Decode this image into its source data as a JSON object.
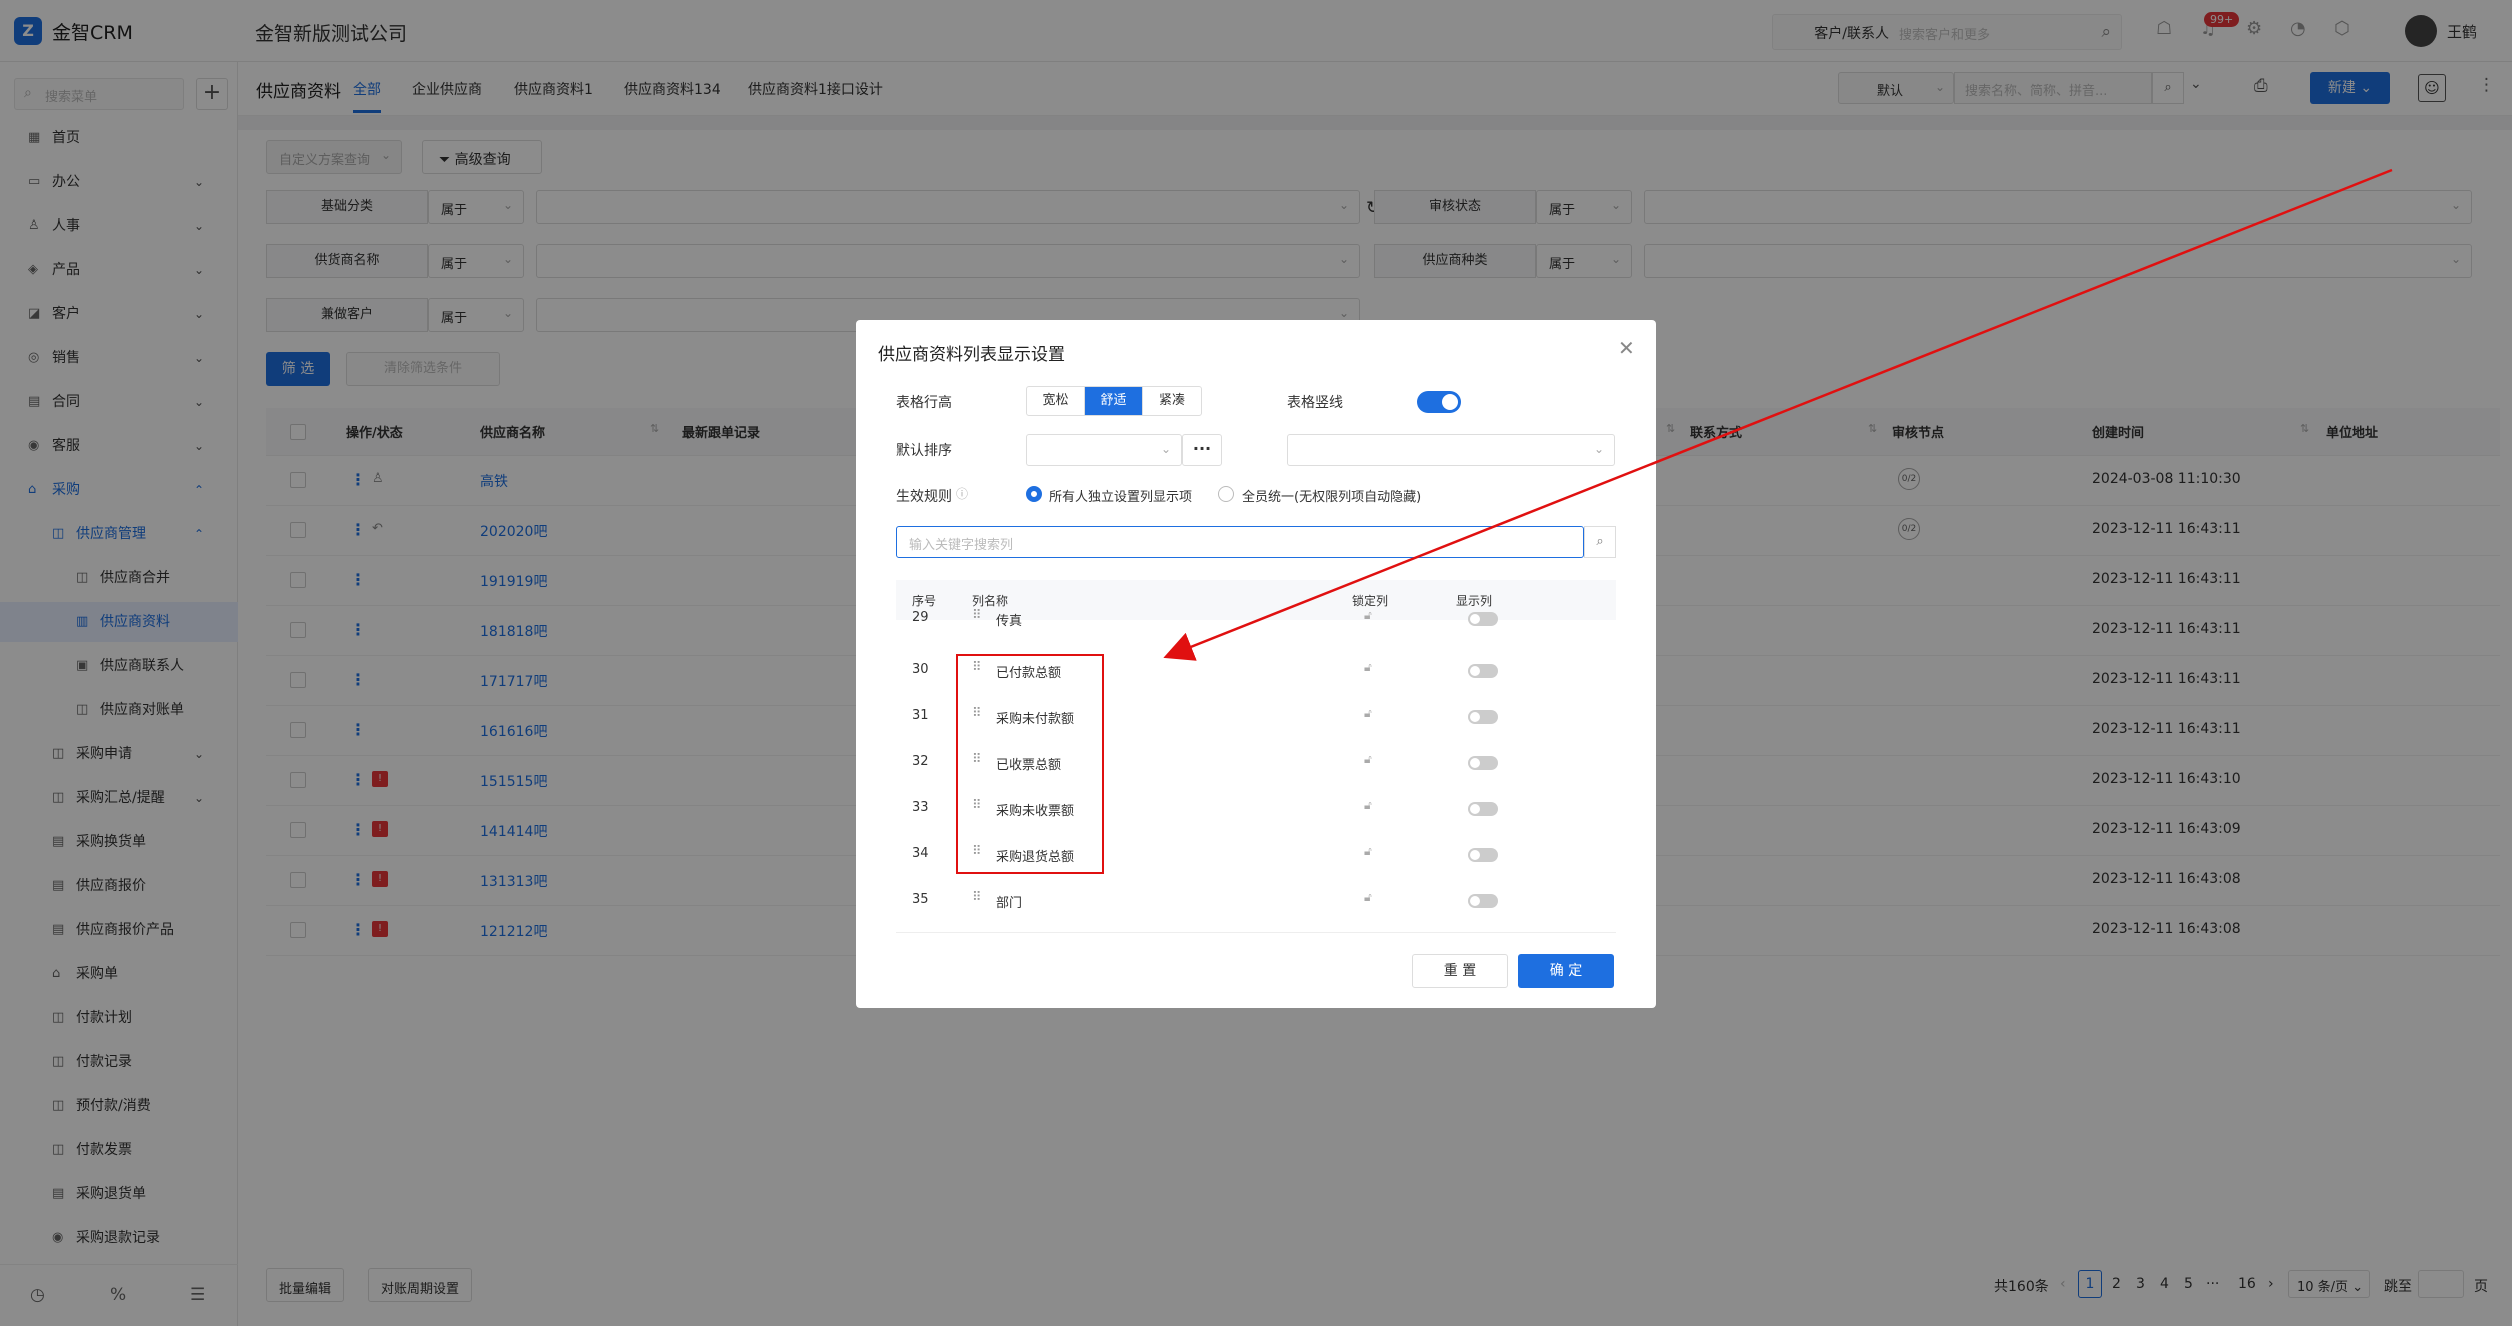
{
  "app": {
    "logo": "金智CRM",
    "company": "金智新版测试公司"
  },
  "topbar": {
    "search_type": "客户/联系人",
    "search_placeholder": "搜索客户和更多",
    "badge": "99+",
    "username": "王鹤"
  },
  "sidebar": {
    "search_placeholder": "搜索菜单",
    "items": [
      {
        "label": "首页"
      },
      {
        "label": "办公"
      },
      {
        "label": "人事"
      },
      {
        "label": "产品"
      },
      {
        "label": "客户"
      },
      {
        "label": "销售"
      },
      {
        "label": "合同"
      },
      {
        "label": "客服"
      },
      {
        "label": "采购"
      },
      {
        "label": "供应商管理"
      },
      {
        "label": "供应商合并"
      },
      {
        "label": "供应商资料"
      },
      {
        "label": "供应商联系人"
      },
      {
        "label": "供应商对账单"
      },
      {
        "label": "采购申请"
      },
      {
        "label": "采购汇总/提醒"
      },
      {
        "label": "采购换货单"
      },
      {
        "label": "供应商报价"
      },
      {
        "label": "供应商报价产品"
      },
      {
        "label": "采购单"
      },
      {
        "label": "付款计划"
      },
      {
        "label": "付款记录"
      },
      {
        "label": "预付款/消费"
      },
      {
        "label": "付款发票"
      },
      {
        "label": "采购退货单"
      },
      {
        "label": "采购退款记录"
      }
    ]
  },
  "page": {
    "title": "供应商资料",
    "tabs": [
      "全部",
      "企业供应商",
      "供应商资料1",
      "供应商资料134",
      "供应商资料1接口设计"
    ],
    "view_select": "默认",
    "search_placeholder": "搜索名称、简称、拼音...",
    "new_button": "新建",
    "custom_query": "自定义方案查询",
    "advanced_query": "高级查询",
    "filters": {
      "f1": "基础分类",
      "f2": "供货商名称",
      "f3": "兼做客户",
      "f4": "审核状态",
      "f5": "供应商种类",
      "op": "属于"
    },
    "filter_button": "筛 选",
    "clear_button": "清除筛选条件"
  },
  "table": {
    "columns": {
      "action": "操作/状态",
      "name": "供应商名称",
      "latest": "最新跟单记录",
      "contact": "联系方式",
      "audit": "审核节点",
      "created": "创建时间",
      "address": "单位地址"
    },
    "rows": [
      {
        "name": "高铁",
        "node": "0/2",
        "time": "2024-03-08 11:10:30"
      },
      {
        "name": "202020吧",
        "node": "0/2",
        "time": "2023-12-11 16:43:11"
      },
      {
        "name": "191919吧",
        "node": "",
        "time": "2023-12-11 16:43:11"
      },
      {
        "name": "181818吧",
        "node": "",
        "time": "2023-12-11 16:43:11"
      },
      {
        "name": "171717吧",
        "node": "",
        "time": "2023-12-11 16:43:11"
      },
      {
        "name": "161616吧",
        "node": "",
        "time": "2023-12-11 16:43:11"
      },
      {
        "name": "151515吧",
        "node": "",
        "time": "2023-12-11 16:43:10"
      },
      {
        "name": "141414吧",
        "node": "",
        "time": "2023-12-11 16:43:09"
      },
      {
        "name": "131313吧",
        "node": "",
        "time": "2023-12-11 16:43:08"
      },
      {
        "name": "121212吧",
        "node": "",
        "time": "2023-12-11 16:43:08"
      }
    ]
  },
  "bottom": {
    "batch_edit": "批量编辑",
    "period_setting": "对账周期设置",
    "total": "共160条",
    "pages": [
      "1",
      "2",
      "3",
      "4",
      "5",
      "···",
      "16"
    ],
    "page_size": "10 条/页",
    "jump": "跳至",
    "page_unit": "页"
  },
  "modal": {
    "title": "供应商资料列表显示设置",
    "row_height_label": "表格行高",
    "row_height_options": [
      "宽松",
      "舒适",
      "紧凑"
    ],
    "vline_label": "表格竖线",
    "sort_label": "默认排序",
    "rule_label": "生效规则",
    "rule_opt1": "所有人独立设置列显示项",
    "rule_opt2": "全员统一(无权限列项自动隐藏)",
    "search_placeholder": "输入关键字搜索列",
    "col_headers": {
      "no": "序号",
      "name": "列名称",
      "lock": "锁定列",
      "show": "显示列"
    },
    "rows": [
      {
        "no": "29",
        "name": "传真"
      },
      {
        "no": "30",
        "name": "已付款总额"
      },
      {
        "no": "31",
        "name": "采购未付款额"
      },
      {
        "no": "32",
        "name": "已收票总额"
      },
      {
        "no": "33",
        "name": "采购未收票额"
      },
      {
        "no": "34",
        "name": "采购退货总额"
      },
      {
        "no": "35",
        "name": "部门"
      }
    ],
    "reset": "重 置",
    "confirm": "确 定"
  },
  "colors": {
    "accent": "#1e6fe0",
    "highlight": "#e01010"
  }
}
